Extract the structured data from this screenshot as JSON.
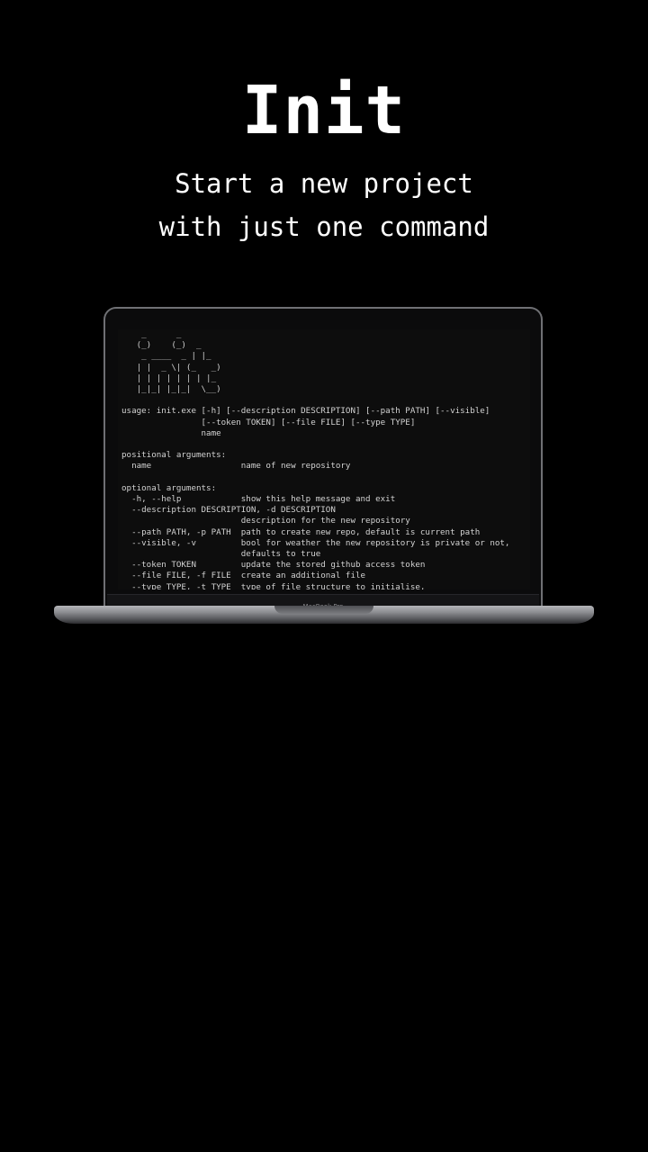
{
  "hero": {
    "title": "Init",
    "subtitle": "Start a new project with just one command"
  },
  "device": {
    "model_label": "MacBook Pro"
  },
  "terminal": {
    "output": "    _      _\n   (_)    (_)  _\n    _ ____  _ | |_\n   | |  _ \\| (_   _)\n   | | | | | | | |_\n   |_|_| |_|_|  \\__)\n\nusage: init.exe [-h] [--description DESCRIPTION] [--path PATH] [--visible]\n                [--token TOKEN] [--file FILE] [--type TYPE]\n                name\n\npositional arguments:\n  name                  name of new repository\n\noptional arguments:\n  -h, --help            show this help message and exit\n  --description DESCRIPTION, -d DESCRIPTION\n                        description for the new repository\n  --path PATH, -p PATH  path to create new repo, default is current path\n  --visible, -v         bool for weather the new repository is private or not,\n                        defaults to true\n  --token TOKEN         update the stored github access token\n  --file FILE, -f FILE  create an additional file\n  --type TYPE, -t TYPE  type of file structure to initialise,"
  },
  "colors": {
    "background": "#000000",
    "text": "#ffffff",
    "terminal_text": "#d2d2d2",
    "laptop_frame": "#6f7074"
  }
}
